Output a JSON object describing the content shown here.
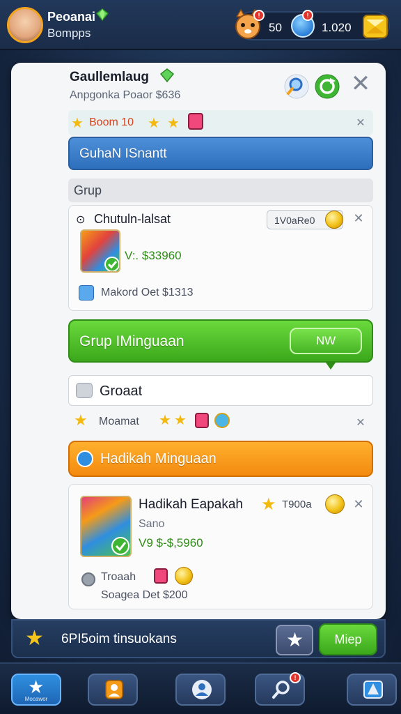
{
  "player": {
    "name": "Peoanai",
    "subtitle": "Bompps"
  },
  "currency": {
    "value_1": "50",
    "value_2": "1.020"
  },
  "panel": {
    "title": "Gaullemlaug",
    "subtitle": "Anpgonka Poaor $636",
    "reward_strip": "Boom 10",
    "blue_bar": "GuhaN ISnantt",
    "section_label": "Grup",
    "card1": {
      "title": "Chutuln-lalsat",
      "price_tag": "1V0aRe0",
      "value": "V:. $33960",
      "footer": "Makord Oet $1313"
    },
    "green_bar": {
      "label": "Grup IMinguaan",
      "button": "NW"
    },
    "input_row": "Groaat",
    "reward_strip_2": "Moamat",
    "orange_bar": "Hadikah Minguaan",
    "card2": {
      "title": "Hadikah Eapakah",
      "price_tag": "T900a",
      "sub": "Sano",
      "value": "V9 $-$,5960",
      "line1": "Troaah",
      "line2": "Soagea Det $200"
    }
  },
  "status_bar": {
    "label": "6PI5oim tinsuokans",
    "button": "Miep"
  },
  "nav": {
    "first_label": "Mocawor"
  },
  "colors": {
    "accent_blue": "#2e6fbd",
    "accent_green": "#3ba81b",
    "accent_orange": "#f38a0e",
    "panel_bg": "#f4f6f8",
    "backdrop": "#1a2d4a"
  },
  "icons": {
    "top": [
      "player-avatar",
      "cat-icon",
      "blue-coin-icon",
      "gem-icon"
    ],
    "panel_header": [
      "search-icon",
      "refresh-icon",
      "close-icon"
    ],
    "nav": [
      "star-icon",
      "profile-icon",
      "friends-icon",
      "search-icon",
      "shop-icon"
    ]
  }
}
